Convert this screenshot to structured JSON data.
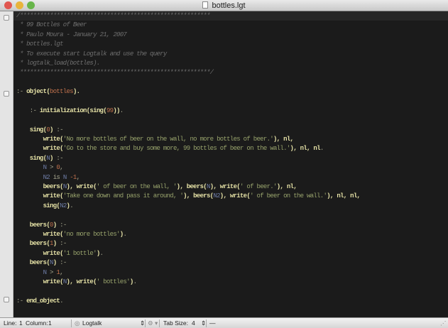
{
  "window": {
    "title": "bottles.lgt",
    "colors": {
      "close": "#e0564f",
      "minimize": "#e8b43c",
      "zoom": "#68b54a"
    }
  },
  "editor": {
    "lines": [
      [
        [
          "/*********************************************************",
          "c"
        ]
      ],
      [
        [
          " * 99 Bottles of Beer",
          "c"
        ]
      ],
      [
        [
          " * Paulo Moura - January 21, 2007",
          "c"
        ]
      ],
      [
        [
          " * bottles.lgt",
          "c"
        ]
      ],
      [
        [
          " * To execute start Logtalk and use the query",
          "c"
        ]
      ],
      [
        [
          " * logtalk_load(bottles).",
          "c"
        ]
      ],
      [
        [
          " *********************************************************/",
          "c"
        ]
      ],
      [],
      [
        [
          ":- ",
          "o"
        ],
        [
          "object",
          "k"
        ],
        [
          "(",
          "k"
        ],
        [
          "bottles",
          "n"
        ],
        [
          ").",
          "k"
        ]
      ],
      [],
      [
        [
          "    :- ",
          "o"
        ],
        [
          "initialization",
          "k"
        ],
        [
          "(",
          "k"
        ],
        [
          "sing",
          "k"
        ],
        [
          "(",
          "k"
        ],
        [
          "99",
          "n"
        ],
        [
          "))",
          "k"
        ],
        [
          ".",
          "o"
        ]
      ],
      [],
      [
        [
          "    sing",
          "k"
        ],
        [
          "(",
          "k"
        ],
        [
          "0",
          "n"
        ],
        [
          ")",
          "k"
        ],
        [
          " :-",
          "o"
        ]
      ],
      [
        [
          "        write",
          "k"
        ],
        [
          "(",
          "k"
        ],
        [
          "'No more bottles of beer on the wall, no more bottles of beer.'",
          "s"
        ],
        [
          "), nl,",
          "k"
        ]
      ],
      [
        [
          "        write",
          "k"
        ],
        [
          "(",
          "k"
        ],
        [
          "'Go to the store and buy some more, 99 bottles of beer on the wall.'",
          "s"
        ],
        [
          "), nl, nl",
          "k"
        ],
        [
          ".",
          "o"
        ]
      ],
      [
        [
          "    sing",
          "k"
        ],
        [
          "(",
          "k"
        ],
        [
          "N",
          "v"
        ],
        [
          ")",
          "k"
        ],
        [
          " :-",
          "o"
        ]
      ],
      [
        [
          "        N",
          "v"
        ],
        [
          " > ",
          "o"
        ],
        [
          "0",
          "n"
        ],
        [
          ",",
          "o"
        ]
      ],
      [
        [
          "        N2",
          "v"
        ],
        [
          " is ",
          "o"
        ],
        [
          "N",
          "v"
        ],
        [
          " -1",
          "n"
        ],
        [
          ",",
          "o"
        ]
      ],
      [
        [
          "        beers",
          "k"
        ],
        [
          "(",
          "k"
        ],
        [
          "N",
          "v"
        ],
        [
          "), write(",
          "k"
        ],
        [
          "' of beer on the wall, '",
          "s"
        ],
        [
          "), beers(",
          "k"
        ],
        [
          "N",
          "v"
        ],
        [
          "), write(",
          "k"
        ],
        [
          "' of beer.'",
          "s"
        ],
        [
          "), nl,",
          "k"
        ]
      ],
      [
        [
          "        write",
          "k"
        ],
        [
          "(",
          "k"
        ],
        [
          "'Take one down and pass it around, '",
          "s"
        ],
        [
          "), beers(",
          "k"
        ],
        [
          "N2",
          "v"
        ],
        [
          "), write(",
          "k"
        ],
        [
          "' of beer on the wall.'",
          "s"
        ],
        [
          "), nl, nl,",
          "k"
        ]
      ],
      [
        [
          "        sing",
          "k"
        ],
        [
          "(",
          "k"
        ],
        [
          "N2",
          "v"
        ],
        [
          ")",
          "k"
        ],
        [
          ".",
          "o"
        ]
      ],
      [],
      [
        [
          "    beers",
          "k"
        ],
        [
          "(",
          "k"
        ],
        [
          "0",
          "n"
        ],
        [
          ")",
          "k"
        ],
        [
          " :-",
          "o"
        ]
      ],
      [
        [
          "        write",
          "k"
        ],
        [
          "(",
          "k"
        ],
        [
          "'no more bottles'",
          "s"
        ],
        [
          ")",
          "k"
        ],
        [
          ".",
          "o"
        ]
      ],
      [
        [
          "    beers",
          "k"
        ],
        [
          "(",
          "k"
        ],
        [
          "1",
          "n"
        ],
        [
          ")",
          "k"
        ],
        [
          " :-",
          "o"
        ]
      ],
      [
        [
          "        write",
          "k"
        ],
        [
          "(",
          "k"
        ],
        [
          "'1 bottle'",
          "s"
        ],
        [
          ")",
          "k"
        ],
        [
          ".",
          "o"
        ]
      ],
      [
        [
          "    beers",
          "k"
        ],
        [
          "(",
          "k"
        ],
        [
          "N",
          "v"
        ],
        [
          ")",
          "k"
        ],
        [
          " :-",
          "o"
        ]
      ],
      [
        [
          "        N",
          "v"
        ],
        [
          " > ",
          "o"
        ],
        [
          "1",
          "n"
        ],
        [
          ",",
          "o"
        ]
      ],
      [
        [
          "        write",
          "k"
        ],
        [
          "(",
          "k"
        ],
        [
          "N",
          "v"
        ],
        [
          "), write(",
          "k"
        ],
        [
          "' bottles'",
          "s"
        ],
        [
          ")",
          "k"
        ],
        [
          ".",
          "o"
        ]
      ],
      [],
      [
        [
          ":- ",
          "o"
        ],
        [
          "end_object",
          "k"
        ],
        [
          ".",
          "o"
        ]
      ]
    ]
  },
  "statusbar": {
    "line_label": "Line:",
    "line": "1",
    "column_label": "Column:",
    "column": "1",
    "language": "Logtalk",
    "tab_size_label": "Tab Size:",
    "tab_size": "4",
    "symbol": "—"
  }
}
